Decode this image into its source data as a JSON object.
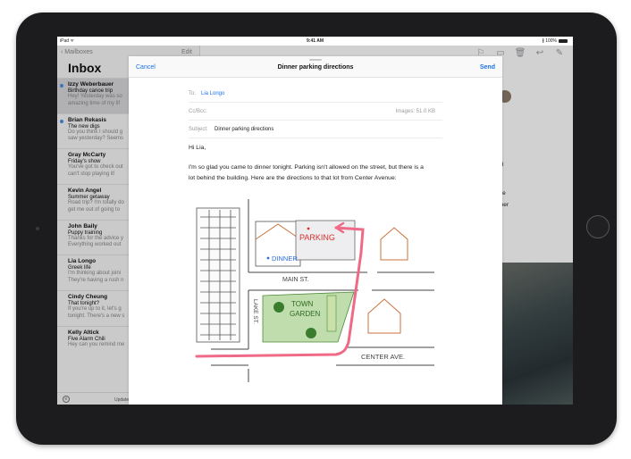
{
  "status_bar": {
    "left": "iPad ᯤ",
    "time": "9:41 AM",
    "right": "∦ 100%"
  },
  "mail_list": {
    "back_label": "Mailboxes",
    "edit_label": "Edit",
    "title": "Inbox",
    "messages": [
      {
        "from": "Izzy Weberbauer",
        "subject": "Birthday canoe trip",
        "preview1": "Hey! Yesterday was so",
        "preview2": "amazing time of my lif"
      },
      {
        "from": "Brian Rekasis",
        "subject": "The new digs",
        "preview1": "Do you think I should g",
        "preview2": "saw yesterday? Seems"
      },
      {
        "from": "Gray McCarty",
        "subject": "Friday's show",
        "preview1": "You've got to check out",
        "preview2": "can't stop playing it!"
      },
      {
        "from": "Kevin Angel",
        "subject": "Summer getaway",
        "preview1": "Road trip? I'm totally do",
        "preview2": "get me out of going to"
      },
      {
        "from": "John Baily",
        "subject": "Puppy training",
        "preview1": "Thanks for the advice y",
        "preview2": "Everything worked out"
      },
      {
        "from": "Lia Longo",
        "subject": "Greek life",
        "preview1": "I'm thinking about joini",
        "preview2": "They're having a rush n"
      },
      {
        "from": "Cindy Cheung",
        "subject": "That tonight?",
        "preview1": "If you're up to it, let's g",
        "preview2": "tonight. There's a new s"
      },
      {
        "from": "Kelly Altick",
        "subject": "Five Alarm Chili",
        "preview1": "Hey can you remind me",
        "preview2": ""
      }
    ],
    "footer_text": "Update"
  },
  "detail": {
    "fragment_1": "nd",
    "fragment_2": "like",
    "fragment_3": "nner"
  },
  "compose": {
    "cancel_label": "Cancel",
    "title": "Dinner parking directions",
    "send_label": "Send",
    "to_label": "To:",
    "to_value": "Lia Longo",
    "cc_label": "Cc/Bcc:",
    "images_label": "Images: 51.0 KB",
    "subject_label": "Subject:",
    "subject_value": "Dinner parking directions",
    "greeting": "Hi Lia,",
    "body_line1": "I'm so glad you came to dinner tonight. Parking isn't allowed on the street, but there is a",
    "body_line2": "lot behind the building. Here are the directions to that lot from Center Avenue:"
  },
  "sketch": {
    "parking": "PARKING",
    "dinner": "DINNER",
    "main_st": "MAIN ST.",
    "lake_st": "LAKE ST.",
    "town_garden_1": "TOWN",
    "town_garden_2": "GARDEN",
    "center_ave": "CENTER AVE."
  },
  "colors": {
    "accent_blue": "#1a73e8",
    "route_pink": "#ef6a86",
    "garden_green": "#8cc26a"
  }
}
